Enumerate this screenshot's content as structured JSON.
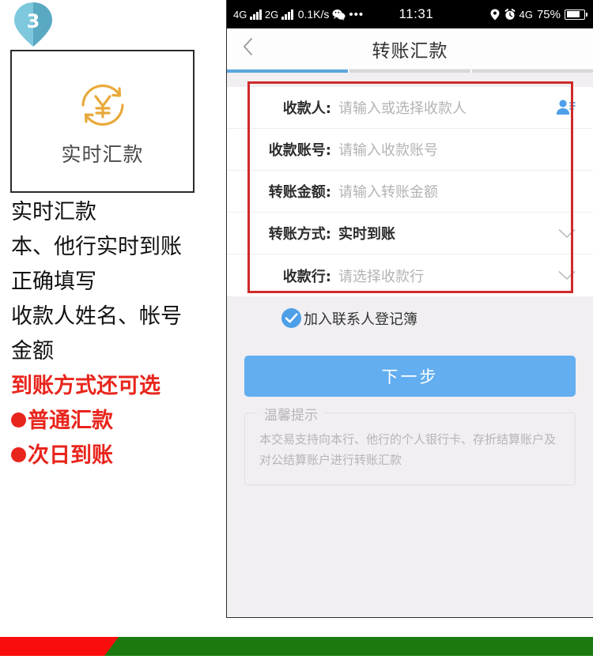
{
  "annotation": {
    "step_badge": "3",
    "card": {
      "icon": "yen-refresh-icon",
      "label": "实时汇款"
    },
    "notes": [
      {
        "text": "实时汇款",
        "style": "black"
      },
      {
        "text": "本、他行实时到账",
        "style": "black"
      },
      {
        "text": "正确填写",
        "style": "black"
      },
      {
        "text": "收款人姓名、帐号",
        "style": "black"
      },
      {
        "text": "金额",
        "style": "black"
      },
      {
        "text": "到账方式还可选",
        "style": "red"
      },
      {
        "text": "普通汇款",
        "style": "red-bullet"
      },
      {
        "text": "次日到账",
        "style": "red-bullet"
      }
    ]
  },
  "phone": {
    "statusbar": {
      "net1": "4G",
      "net2": "2G",
      "speed": "0.1K/s",
      "wechat_icon": "wechat-icon",
      "more_dots": "•••",
      "time": "11:31",
      "location_icon": "location-pin-icon",
      "alarm_icon": "alarm-clock-icon",
      "net3": "4G",
      "battery_percent": "75%"
    },
    "navbar": {
      "back_icon": "chevron-left-icon",
      "title": "转账汇款"
    },
    "steps": {
      "total": 3,
      "active_index": 0,
      "active_color": "#5ba7e0",
      "inactive_color": "#d8d8d8"
    },
    "form": {
      "highlight_color": "#cf2a2a",
      "rows": [
        {
          "label": "收款人:",
          "value": "请输入或选择收款人",
          "filled": false,
          "trailing_icon": "contact-person-icon"
        },
        {
          "label": "收款账号:",
          "value": "请输入收款账号",
          "filled": false,
          "trailing_icon": ""
        },
        {
          "label": "转账金额:",
          "value": "请输入转账金额",
          "filled": false,
          "trailing_icon": ""
        },
        {
          "label": "转账方式:",
          "value": "实时到账",
          "filled": true,
          "trailing_icon": "chevron-down-icon"
        },
        {
          "label": "收款行:",
          "value": "请选择收款行",
          "filled": false,
          "trailing_icon": "chevron-down-icon"
        }
      ]
    },
    "checkbox": {
      "icon": "check-circle-icon",
      "checked": true,
      "label": "加入联系人登记簿"
    },
    "next_button": {
      "label": "下一步",
      "color": "#62aef0"
    },
    "tips": {
      "legend": "温馨提示",
      "body": "本交易支持向本行、他行的个人银行卡、存折结算账户及对公结算账户进行转账汇款"
    }
  },
  "footer": {
    "red_color": "#fb0d0d",
    "green_color": "#1a7a0f"
  }
}
